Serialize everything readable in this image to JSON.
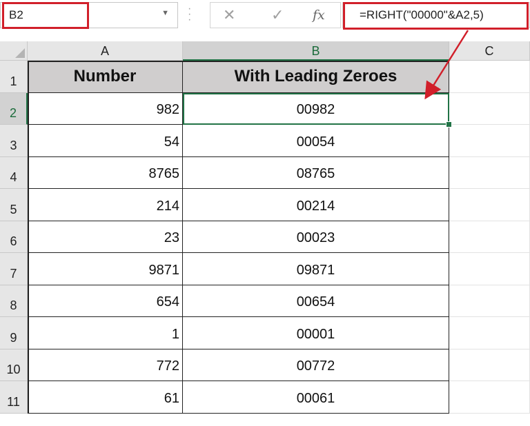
{
  "formula_bar": {
    "name_box": "B2",
    "cancel_icon": "✕",
    "enter_icon": "✓",
    "fx_label": "fx",
    "formula": "=RIGHT(\"00000\"&A2,5)"
  },
  "columns": [
    "A",
    "B",
    "C"
  ],
  "rows": [
    "1",
    "2",
    "3",
    "4",
    "5",
    "6",
    "7",
    "8",
    "9",
    "10",
    "11"
  ],
  "header": {
    "a1": "Number",
    "b1": "With Leading Zeroes"
  },
  "data": [
    {
      "a": "982",
      "b": "00982"
    },
    {
      "a": "54",
      "b": "00054"
    },
    {
      "a": "8765",
      "b": "08765"
    },
    {
      "a": "214",
      "b": "00214"
    },
    {
      "a": "23",
      "b": "00023"
    },
    {
      "a": "9871",
      "b": "09871"
    },
    {
      "a": "654",
      "b": "00654"
    },
    {
      "a": "1",
      "b": "00001"
    },
    {
      "a": "772",
      "b": "00772"
    },
    {
      "a": "61",
      "b": "00061"
    }
  ],
  "colors": {
    "callout": "#d11f2a",
    "selection": "#217346",
    "header_fill": "#d0cece"
  }
}
